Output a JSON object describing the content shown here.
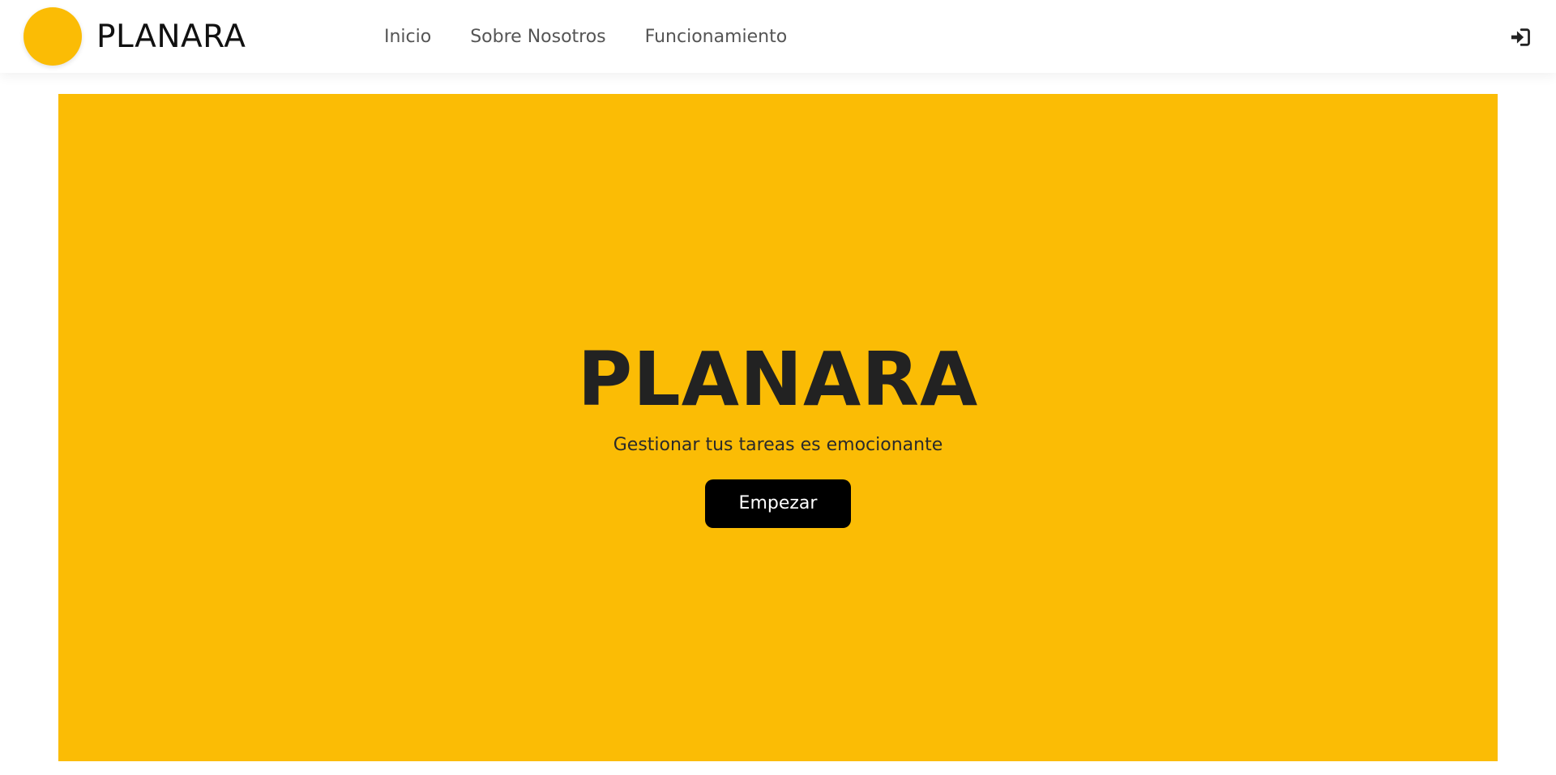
{
  "colors": {
    "accent": "#fbbc05",
    "button_bg": "#000000",
    "nav_text": "#555555"
  },
  "navbar": {
    "brand_name": "PLANARA",
    "links": [
      "Inicio",
      "Sobre Nosotros",
      "Funcionamiento"
    ],
    "login_icon": "sign-in-icon"
  },
  "hero": {
    "title": "PLANARA",
    "subtitle": "Gestionar tus tareas es emocionante",
    "button_label": "Empezar"
  }
}
